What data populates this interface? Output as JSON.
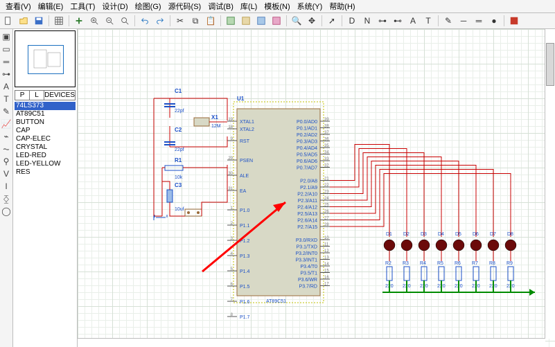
{
  "menu": {
    "items": [
      "查看(V)",
      "编辑(E)",
      "工具(T)",
      "设计(D)",
      "绘图(G)",
      "源代码(S)",
      "调试(B)",
      "库(L)",
      "模板(N)",
      "系统(Y)",
      "帮助(H)"
    ]
  },
  "toolbar": {
    "icons": [
      "new",
      "open",
      "save",
      "sep",
      "grid",
      "sep",
      "plus",
      "zoom-in",
      "zoom-out",
      "zoom-all",
      "sep",
      "undo",
      "redo",
      "sep",
      "cut",
      "copy",
      "paste",
      "sep",
      "block1",
      "block2",
      "block3",
      "block4",
      "sep",
      "find",
      "move",
      "sep",
      "arrow",
      "sep",
      "device",
      "net",
      "pin",
      "term",
      "label",
      "text",
      "sep",
      "script",
      "wire",
      "bus",
      "junction",
      "sep",
      "report"
    ]
  },
  "lefttools": {
    "icons": [
      "select",
      "component",
      "bus",
      "terminal",
      "label",
      "text",
      "script",
      "graph",
      "tape",
      "generator",
      "probe",
      "voltage",
      "current",
      "instrument",
      "2d"
    ]
  },
  "devpanel": {
    "tabs": [
      "P",
      "L",
      "DEVICES"
    ],
    "items": [
      "74LS373",
      "AT89C51",
      "BUTTON",
      "CAP",
      "CAP-ELEC",
      "CRYSTAL",
      "LED-RED",
      "LED-YELLOW",
      "RES"
    ],
    "selected": 0
  },
  "schematic": {
    "chip": {
      "ref": "U1",
      "name": "AT89C51",
      "left": [
        {
          "num": "19",
          "name": "XTAL1"
        },
        {
          "num": "18",
          "name": "XTAL2"
        },
        {
          "num": "",
          "name": ""
        },
        {
          "num": "9",
          "name": "RST"
        },
        {
          "num": "",
          "name": ""
        },
        {
          "num": "29",
          "name": "PSEN"
        },
        {
          "num": "30",
          "name": "ALE"
        },
        {
          "num": "31",
          "name": "EA"
        },
        {
          "num": "",
          "name": ""
        },
        {
          "num": "1",
          "name": "P1.0"
        },
        {
          "num": "2",
          "name": "P1.1"
        },
        {
          "num": "3",
          "name": "P1.2"
        },
        {
          "num": "4",
          "name": "P1.3"
        },
        {
          "num": "5",
          "name": "P1.4"
        },
        {
          "num": "6",
          "name": "P1.5"
        },
        {
          "num": "7",
          "name": "P1.6"
        },
        {
          "num": "8",
          "name": "P1.7"
        }
      ],
      "right": [
        {
          "num": "39",
          "name": "P0.0/AD0"
        },
        {
          "num": "38",
          "name": "P0.1/AD1"
        },
        {
          "num": "37",
          "name": "P0.2/AD2"
        },
        {
          "num": "36",
          "name": "P0.3/AD3"
        },
        {
          "num": "35",
          "name": "P0.4/AD4"
        },
        {
          "num": "34",
          "name": "P0.5/AD5"
        },
        {
          "num": "33",
          "name": "P0.6/AD6"
        },
        {
          "num": "32",
          "name": "P0.7/AD7"
        },
        {
          "num": "",
          "name": ""
        },
        {
          "num": "21",
          "name": "P2.0/A8"
        },
        {
          "num": "22",
          "name": "P2.1/A9"
        },
        {
          "num": "23",
          "name": "P2.2/A10"
        },
        {
          "num": "24",
          "name": "P2.3/A11"
        },
        {
          "num": "25",
          "name": "P2.4/A12"
        },
        {
          "num": "26",
          "name": "P2.5/A13"
        },
        {
          "num": "27",
          "name": "P2.6/A14"
        },
        {
          "num": "28",
          "name": "P2.7/A15"
        },
        {
          "num": "",
          "name": ""
        },
        {
          "num": "10",
          "name": "P3.0/RXD"
        },
        {
          "num": "11",
          "name": "P3.1/TXD"
        },
        {
          "num": "12",
          "name": "P3.2/INT0"
        },
        {
          "num": "13",
          "name": "P3.3/INT1"
        },
        {
          "num": "14",
          "name": "P3.4/T0"
        },
        {
          "num": "15",
          "name": "P3.5/T1"
        },
        {
          "num": "16",
          "name": "P3.6/WR"
        },
        {
          "num": "17",
          "name": "P3.7/RD"
        }
      ]
    },
    "comp": {
      "C1": {
        "ref": "C1",
        "val": "22pf"
      },
      "C2": {
        "ref": "C2",
        "val": "22pf"
      },
      "X1": {
        "ref": "X1",
        "val": "12M"
      },
      "R1": {
        "ref": "R1",
        "val": "10k"
      },
      "C3": {
        "ref": "C3",
        "val": "10uf"
      }
    },
    "leds": [
      "D1",
      "D2",
      "D3",
      "D4",
      "D5",
      "D6",
      "D7",
      "D8"
    ],
    "res": [
      {
        "ref": "R2",
        "val": "220"
      },
      {
        "ref": "R3",
        "val": "220"
      },
      {
        "ref": "R4",
        "val": "220"
      },
      {
        "ref": "R5",
        "val": "220"
      },
      {
        "ref": "R6",
        "val": "220"
      },
      {
        "ref": "R7",
        "val": "220"
      },
      {
        "ref": "R8",
        "val": "220"
      },
      {
        "ref": "R9",
        "val": "220"
      }
    ]
  }
}
